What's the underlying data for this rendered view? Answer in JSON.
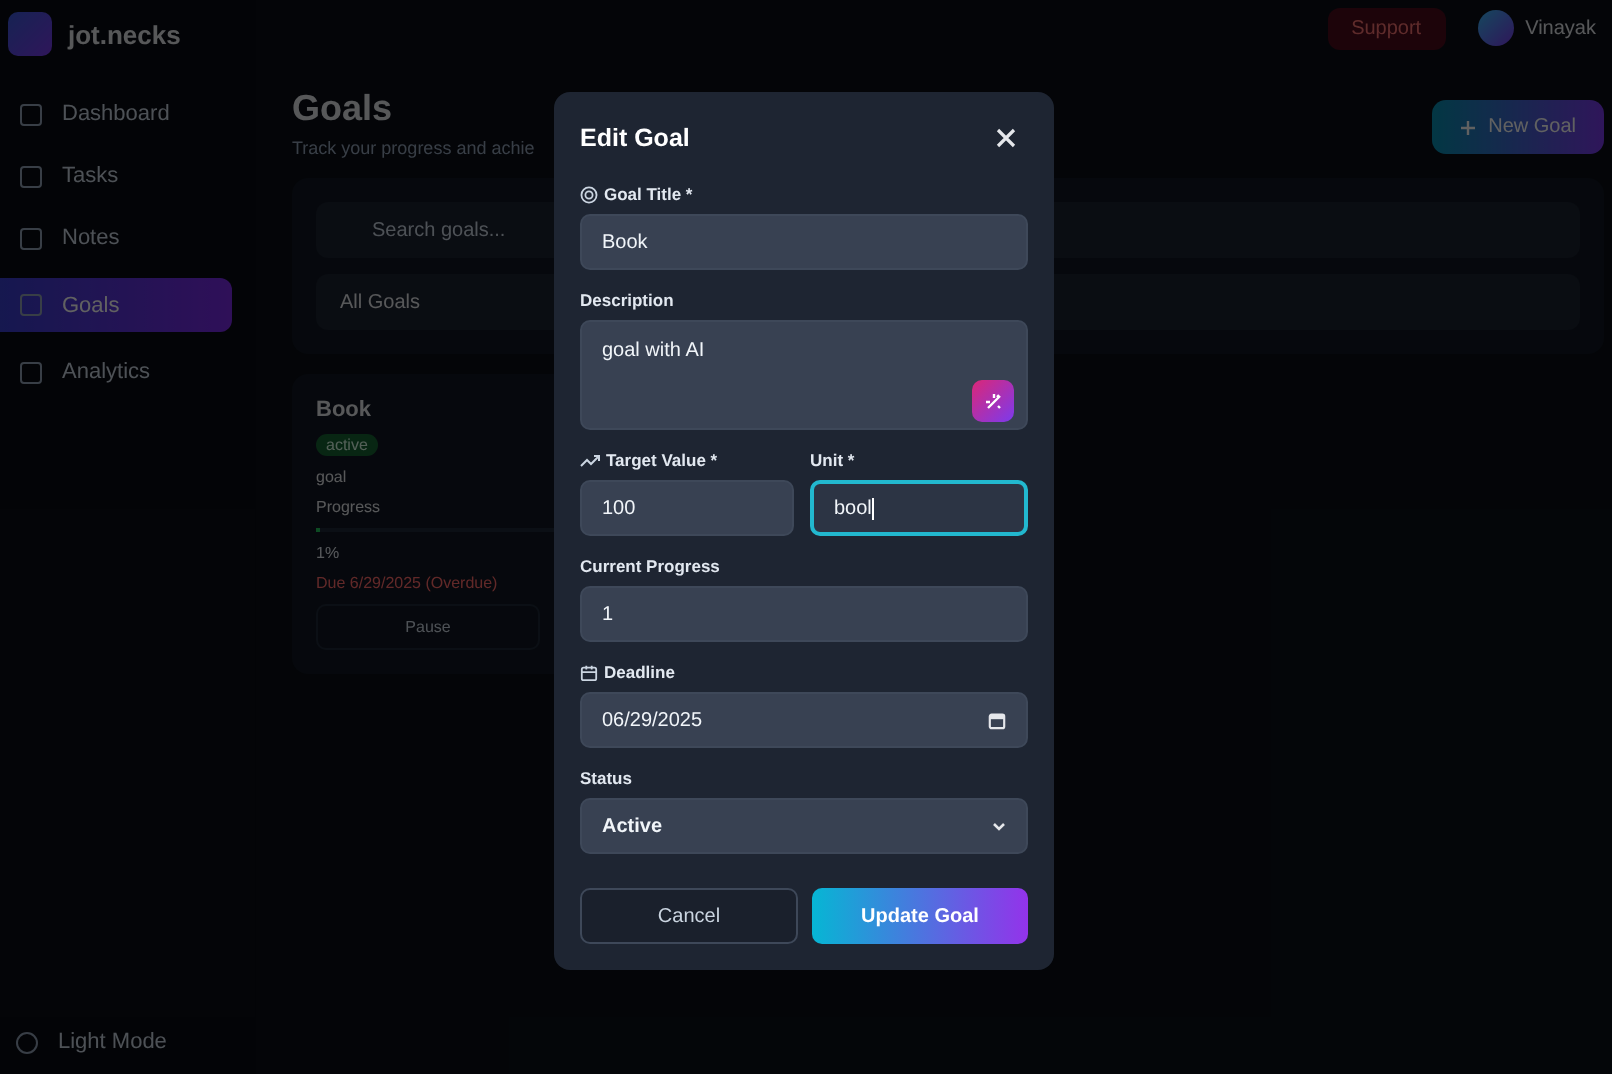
{
  "app": {
    "brand": "jot.necks"
  },
  "header": {
    "support_label": "Support",
    "user_name": "Vinayak"
  },
  "sidebar": {
    "items": [
      {
        "label": "Dashboard",
        "selected": false
      },
      {
        "label": "Tasks",
        "selected": false
      },
      {
        "label": "Notes",
        "selected": false
      },
      {
        "label": "Goals",
        "selected": true
      },
      {
        "label": "Analytics",
        "selected": false
      }
    ],
    "theme_toggle": "Light Mode"
  },
  "page": {
    "title": "Goals",
    "subtitle": "Track your progress and achie",
    "new_button": "New Goal",
    "search": {
      "placeholder": "Search goals..."
    },
    "filter": {
      "value": "All Goals"
    },
    "goal_card": {
      "title": "Book",
      "status": "active",
      "description": "goal",
      "progress_label": "Progress",
      "level": 0.01,
      "progress_text": "1%",
      "deadline_text": "Due 6/29/2025 (Overdue)",
      "pause_button": "Pause"
    }
  },
  "modal": {
    "title": "Edit Goal",
    "title_field": {
      "label": "Goal Title *",
      "value": "Book"
    },
    "description_field": {
      "label": "Description",
      "value": "goal with AI"
    },
    "target_field": {
      "label": "Target Value *",
      "value": "100"
    },
    "unit_field": {
      "label": "Unit *",
      "value": "bool",
      "focused": true
    },
    "progress_field": {
      "label": "Current Progress",
      "value": "1"
    },
    "deadline_field": {
      "label": "Deadline",
      "value": "06/29/2025"
    },
    "status_field": {
      "label": "Status",
      "value": "Active"
    },
    "cancel_button": "Cancel",
    "submit_button": "Update Goal"
  }
}
